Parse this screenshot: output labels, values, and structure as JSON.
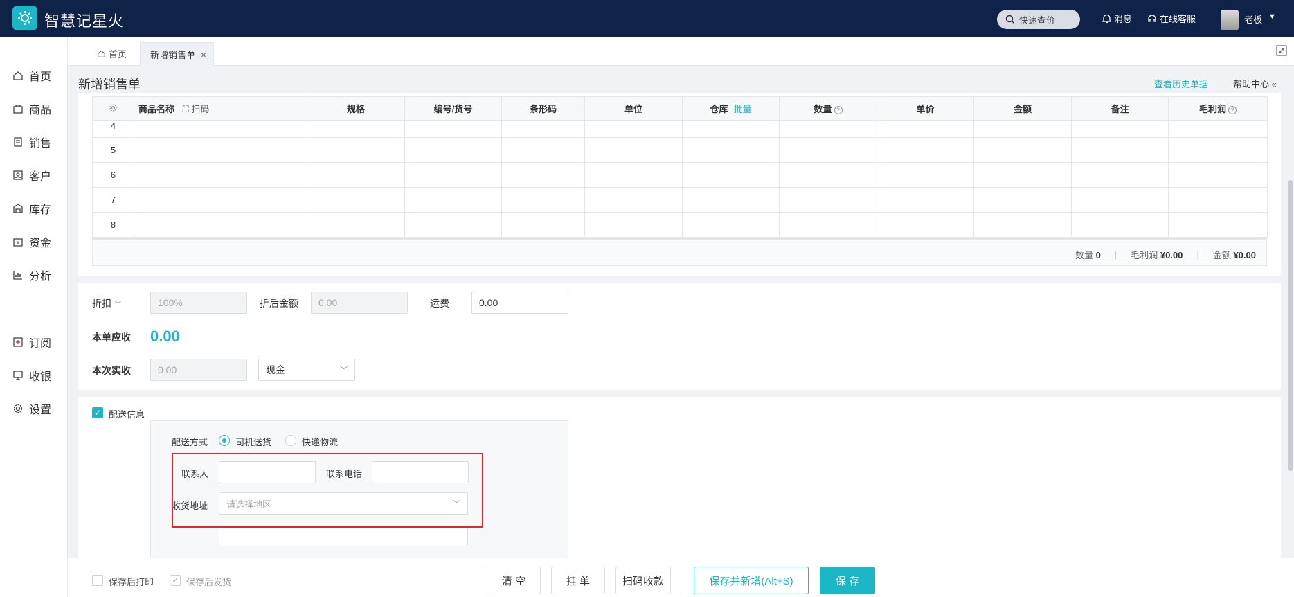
{
  "app": {
    "title": "智慧记星火"
  },
  "topbar": {
    "search_label": "快速查价",
    "message_label": "消息",
    "service_label": "在线客服",
    "user_name": "老板"
  },
  "sidebar": {
    "items": [
      {
        "label": "首页",
        "icon": "home-icon"
      },
      {
        "label": "商品",
        "icon": "bag-icon"
      },
      {
        "label": "销售",
        "icon": "clipboard-icon"
      },
      {
        "label": "客户",
        "icon": "contact-icon"
      },
      {
        "label": "库存",
        "icon": "warehouse-icon"
      },
      {
        "label": "资金",
        "icon": "wallet-icon"
      },
      {
        "label": "分析",
        "icon": "chart-icon"
      },
      {
        "label": "订阅",
        "icon": "subscribe-icon"
      },
      {
        "label": "收银",
        "icon": "cashier-icon"
      },
      {
        "label": "设置",
        "icon": "gear-icon"
      }
    ]
  },
  "tabs": {
    "home": "首页",
    "active": "新增销售单"
  },
  "page": {
    "title": "新增销售单",
    "history_link": "查看历史单据",
    "help_link": "帮助中心"
  },
  "table": {
    "headers": {
      "product_name": "商品名称",
      "scan": "扫码",
      "spec": "规格",
      "code": "编号/货号",
      "barcode": "条形码",
      "unit": "单位",
      "warehouse": "仓库",
      "batch": "批量",
      "qty": "数量",
      "price": "单价",
      "amount": "金额",
      "remark": "备注",
      "profit": "毛利润"
    },
    "row_numbers": [
      "4",
      "5",
      "6",
      "7",
      "8"
    ],
    "summary": {
      "qty_label": "数量",
      "qty_value": "0",
      "profit_label": "毛利润",
      "profit_value": "¥0.00",
      "amount_label": "金额",
      "amount_value": "¥0.00"
    }
  },
  "payment": {
    "discount_label": "折扣",
    "discount_placeholder": "100%",
    "after_discount_label": "折后金额",
    "after_discount_placeholder": "0.00",
    "freight_label": "运费",
    "freight_value": "0.00",
    "receivable_label": "本单应收",
    "receivable_value": "0.00",
    "received_label": "本次实收",
    "received_placeholder": "0.00",
    "method_value": "现金"
  },
  "delivery": {
    "checkbox_label": "配送信息",
    "method_label": "配送方式",
    "option_driver": "司机送货",
    "option_express": "快递物流",
    "contact_label": "联系人",
    "phone_label": "联系电话",
    "address_label": "收货地址",
    "address_placeholder": "请选择地区"
  },
  "bottom": {
    "print_after_save": "保存后打印",
    "ship_after_save": "保存后发货",
    "clear": "清 空",
    "hold": "挂 单",
    "scan_pay": "扫码收款",
    "save_new": "保存并新增(Alt+S)",
    "save": "保 存"
  },
  "colors": {
    "accent": "#1bb7c7",
    "topbar": "#0f2248",
    "highlight": "#e8262a"
  }
}
